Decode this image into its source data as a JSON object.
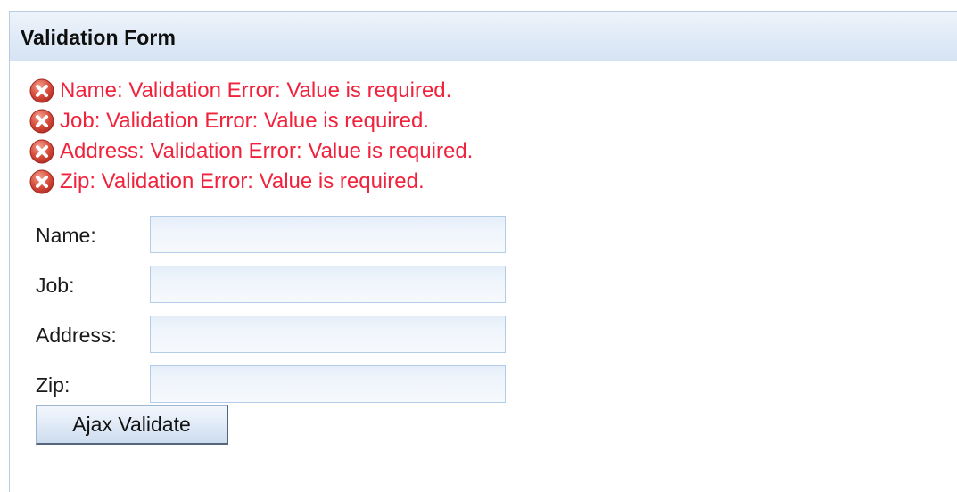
{
  "panel": {
    "title": "Validation Form"
  },
  "messages": [
    {
      "icon": "error-icon",
      "text": "Name: Validation Error: Value is required."
    },
    {
      "icon": "error-icon",
      "text": "Job: Validation Error: Value is required."
    },
    {
      "icon": "error-icon",
      "text": "Address: Validation Error: Value is required."
    },
    {
      "icon": "error-icon",
      "text": "Zip: Validation Error: Value is required."
    }
  ],
  "form": {
    "fields": [
      {
        "label": "Name:",
        "value": ""
      },
      {
        "label": "Job:",
        "value": ""
      },
      {
        "label": "Address:",
        "value": ""
      },
      {
        "label": "Zip:",
        "value": ""
      }
    ],
    "submit_label": "Ajax Validate"
  },
  "colors": {
    "error_text": "#f0223c",
    "error_icon": "#d9483b",
    "header_bg": "#dce8f6",
    "input_border": "#b3cde8"
  }
}
